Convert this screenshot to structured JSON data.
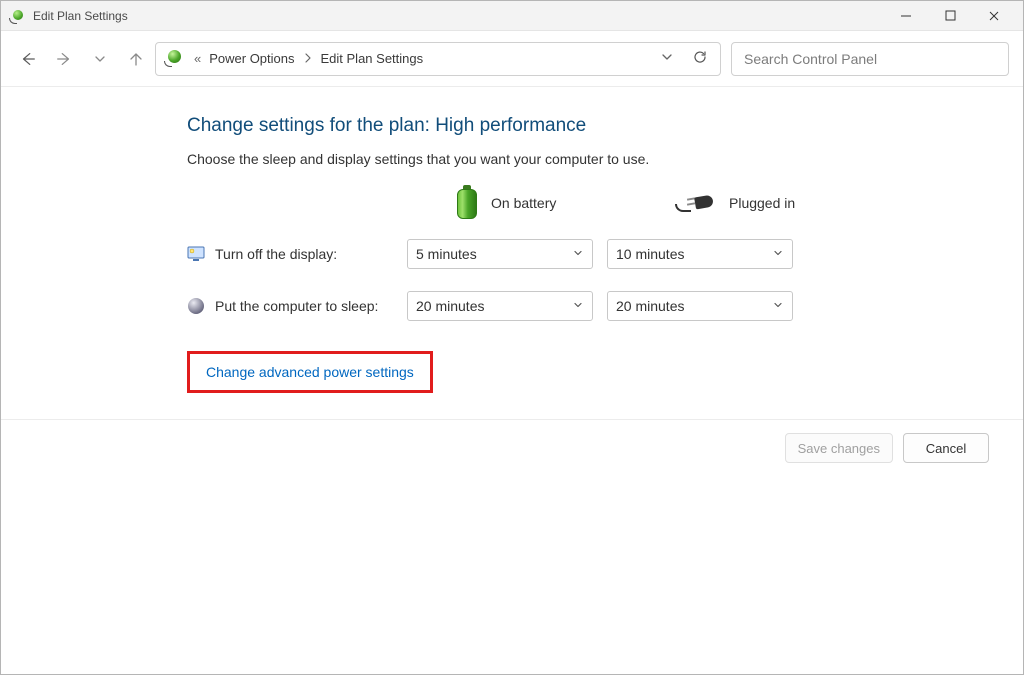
{
  "window": {
    "title": "Edit Plan Settings"
  },
  "breadcrumb": {
    "segments": [
      "Power Options",
      "Edit Plan Settings"
    ]
  },
  "search": {
    "placeholder": "Search Control Panel"
  },
  "heading": "Change settings for the plan: High performance",
  "subtext": "Choose the sleep and display settings that you want your computer to use.",
  "columns": {
    "battery": "On battery",
    "plugged": "Plugged in"
  },
  "rows": {
    "display": {
      "label": "Turn off the display:",
      "battery": "5 minutes",
      "plugged": "10 minutes"
    },
    "sleep": {
      "label": "Put the computer to sleep:",
      "battery": "20 minutes",
      "plugged": "20 minutes"
    }
  },
  "link": {
    "advanced": "Change advanced power settings"
  },
  "buttons": {
    "save": "Save changes",
    "cancel": "Cancel"
  }
}
